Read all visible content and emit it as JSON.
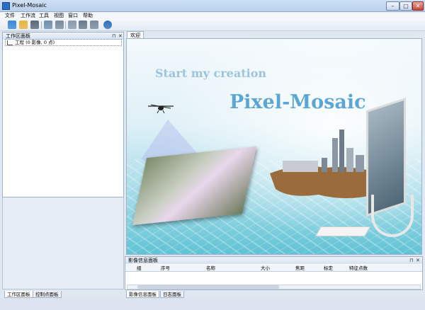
{
  "window": {
    "title": "Pixel-Mosaic",
    "controls": {
      "minimize": "–",
      "maximize": "□",
      "close": "✕"
    }
  },
  "menu": [
    "文件",
    "工作流",
    "工具",
    "视图",
    "窗口",
    "帮助"
  ],
  "toolbar": {
    "icons": [
      "new-project-icon",
      "open-project-icon",
      "save-icon",
      "import-images-icon",
      "export-icon",
      "camera-params-icon",
      "image-list-icon",
      "layers-icon",
      "user-icon"
    ],
    "colors": [
      "#3b8ad8",
      "#e8b63a",
      "#5a6a7a",
      "#6f8fb0",
      "#7a8a9a",
      "#8a9aac",
      "#6a7a8c",
      "#7b8b9b",
      "#2f6fb8"
    ]
  },
  "workspace_panel": {
    "title": "工作区面板",
    "pin": "⊓",
    "close": "✕",
    "tree_root": "工程 (0 影像, 0 点)"
  },
  "left_tabs": [
    "工作区面板",
    "控制点面板"
  ],
  "document_tab": "欢迎",
  "welcome": {
    "tagline": "Start my creation",
    "brand": "Pixel-Mosaic"
  },
  "image_info_panel": {
    "title": "影像信息面板",
    "pin": "⊓",
    "close": "✕",
    "columns": [
      "组",
      "序号",
      "名称",
      "大小",
      "焦距",
      "标定",
      "特征点数"
    ]
  },
  "bottom_tabs": [
    "影像信息面板",
    "日志面板"
  ]
}
